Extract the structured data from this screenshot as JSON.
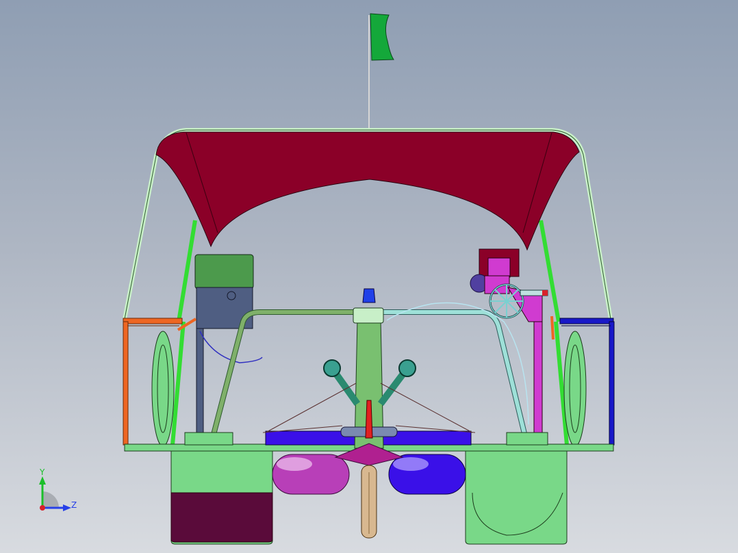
{
  "viewport": {
    "background_top": "#8f9eb3",
    "background_bottom": "#d8dbe0"
  },
  "model": {
    "colors": {
      "canopy": "#8b0028",
      "frame": "#c8efc8",
      "green_tube": "#33dd33",
      "hull": "#79d888",
      "hull_dark": "#5a0b3a",
      "float_purple": "#b83fb8",
      "float_blue": "#3a10e8",
      "flag": "#14a83a",
      "motor": "#d8b890",
      "seat": "#8b0028",
      "helm": "#d03bd0",
      "rail_orange": "#ee6622",
      "rail_blue": "#1818c8",
      "box_top": "#4c9a4c",
      "box_body": "#4f5e82"
    }
  },
  "triad": {
    "y_label": "Y",
    "z_label": "Z",
    "colors": {
      "y": "#1bbf2a",
      "z": "#2740e8",
      "x": "#d8202a"
    }
  }
}
